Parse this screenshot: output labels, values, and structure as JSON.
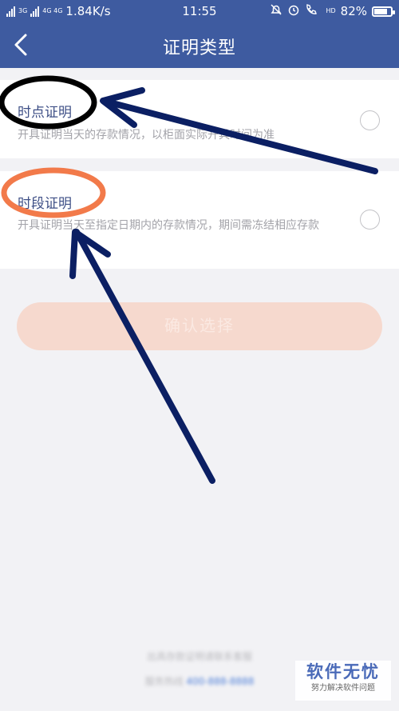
{
  "status_bar": {
    "net_small_1": "3G",
    "net_small_2": "4G 4G",
    "speed": "1.84K/s",
    "time": "11:55",
    "hd_label": "HD",
    "battery": "82%",
    "battery_level": 0.82
  },
  "nav": {
    "title": "证明类型",
    "back_icon": "chevron-left-icon"
  },
  "options": [
    {
      "title": "时点证明",
      "description": "开具证明当天的存款情况，以柜面实际开具时间为准",
      "selected": false
    },
    {
      "title": "时段证明",
      "description": "开具证明当天至指定日期内的存款情况，期间需冻结相应存款",
      "selected": false
    }
  ],
  "confirm_button": {
    "label": "确认选择",
    "enabled": false
  },
  "footer": {
    "line1": "出具存款证明请联系客服",
    "line2_prefix": "服务热线",
    "phone": "400-888-8888"
  },
  "watermark": {
    "title": "软件无忧",
    "subtitle": "努力解决软件问题"
  },
  "colors": {
    "header_bg": "#3e5ba0",
    "option_title": "#3e4f86",
    "confirm_disabled_bg": "#f6d9ce",
    "annotation_black": "#000000",
    "annotation_orange": "#f27a4a",
    "annotation_arrow": "#0b1f63"
  }
}
